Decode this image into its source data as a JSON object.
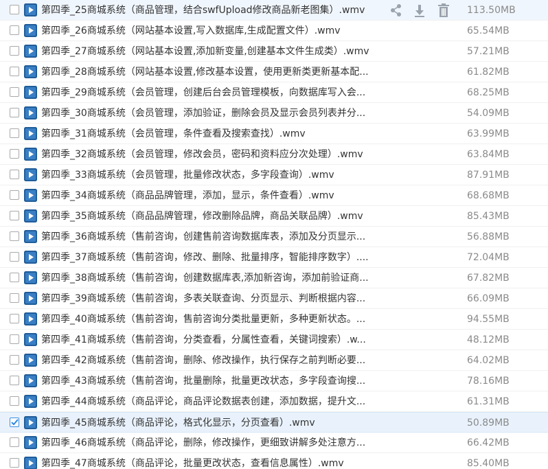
{
  "files": [
    {
      "name": "第四季_25商城系统（商品管理，结合swfUpload修改商品新老图集）.wmv",
      "size": "113.50MB",
      "checked": false,
      "hovered": true
    },
    {
      "name": "第四季_26商城系统（网站基本设置,写入数据库,生成配置文件）.wmv",
      "size": "65.54MB",
      "checked": false,
      "hovered": false
    },
    {
      "name": "第四季_27商城系统（网站基本设置,添加新变量,创建基本文件生成类）.wmv",
      "size": "57.21MB",
      "checked": false,
      "hovered": false
    },
    {
      "name": "第四季_28商城系统（网站基本设置,修改基本设置，使用更新类更新基本配...",
      "size": "61.82MB",
      "checked": false,
      "hovered": false
    },
    {
      "name": "第四季_29商城系统（会员管理，创建后台会员管理模板，向数据库写入会...",
      "size": "68.25MB",
      "checked": false,
      "hovered": false
    },
    {
      "name": "第四季_30商城系统（会员管理，添加验证，删除会员及显示会员列表并分...",
      "size": "54.09MB",
      "checked": false,
      "hovered": false
    },
    {
      "name": "第四季_31商城系统（会员管理，条件查看及搜索查找）.wmv",
      "size": "63.99MB",
      "checked": false,
      "hovered": false
    },
    {
      "name": "第四季_32商城系统（会员管理，修改会员，密码和资料应分次处理）.wmv",
      "size": "63.84MB",
      "checked": false,
      "hovered": false
    },
    {
      "name": "第四季_33商城系统（会员管理，批量修改状态，多字段查询）.wmv",
      "size": "87.91MB",
      "checked": false,
      "hovered": false
    },
    {
      "name": "第四季_34商城系统（商品品牌管理，添加，显示，条件查看）.wmv",
      "size": "68.68MB",
      "checked": false,
      "hovered": false
    },
    {
      "name": "第四季_35商城系统（商品品牌管理，修改删除品牌，商品关联品牌）.wmv",
      "size": "85.43MB",
      "checked": false,
      "hovered": false
    },
    {
      "name": "第四季_36商城系统（售前咨询，创建售前咨询数据库表，添加及分页显示...",
      "size": "56.88MB",
      "checked": false,
      "hovered": false
    },
    {
      "name": "第四季_37商城系统（售前咨询，修改、删除、批量排序，智能排序数字）....",
      "size": "72.04MB",
      "checked": false,
      "hovered": false
    },
    {
      "name": "第四季_38商城系统（售前咨询，创建数据库表,添加新咨询，添加前验证商...",
      "size": "67.82MB",
      "checked": false,
      "hovered": false
    },
    {
      "name": "第四季_39商城系统（售前咨询，多表关联查询、分页显示、判断根据内容...",
      "size": "66.09MB",
      "checked": false,
      "hovered": false
    },
    {
      "name": "第四季_40商城系统（售前咨询，售前咨询分类批量更新，多种更新状态。...",
      "size": "94.55MB",
      "checked": false,
      "hovered": false
    },
    {
      "name": "第四季_41商城系统（售前咨询，分类查看，分属性查看，关键词搜索）.w...",
      "size": "48.12MB",
      "checked": false,
      "hovered": false
    },
    {
      "name": "第四季_42商城系统（售前咨询，删除、修改操作，执行保存之前判断必要...",
      "size": "64.02MB",
      "checked": false,
      "hovered": false
    },
    {
      "name": "第四季_43商城系统（售前咨询，批量删除，批量更改状态，多字段查询搜...",
      "size": "78.16MB",
      "checked": false,
      "hovered": false
    },
    {
      "name": "第四季_44商城系统（商品评论，商品评论数据表创建，添加数据，提升文...",
      "size": "61.31MB",
      "checked": false,
      "hovered": false
    },
    {
      "name": "第四季_45商城系统（商品评论，格式化显示，分页查看）.wmv",
      "size": "50.89MB",
      "checked": true,
      "hovered": false
    },
    {
      "name": "第四季_46商城系统（商品评论，删除，修改操作，更细致讲解多处注意方...",
      "size": "66.42MB",
      "checked": false,
      "hovered": false
    },
    {
      "name": "第四季_47商城系统（商品评论，批量更改状态，查看信息属性）.wmv",
      "size": "85.40MB",
      "checked": false,
      "hovered": false
    }
  ],
  "icons": {
    "file": "video-file-icon",
    "share": "share-icon",
    "download": "download-icon",
    "delete": "trash-icon",
    "check": "checkmark-icon"
  },
  "colors": {
    "icon_blue": "#3a7fc4",
    "icon_dark": "#1f5c99",
    "action_gray": "#9aa3ad",
    "check_blue": "#2e86de",
    "hover_bg": "#f0f6fd",
    "selected_bg": "#e9f2fc"
  }
}
